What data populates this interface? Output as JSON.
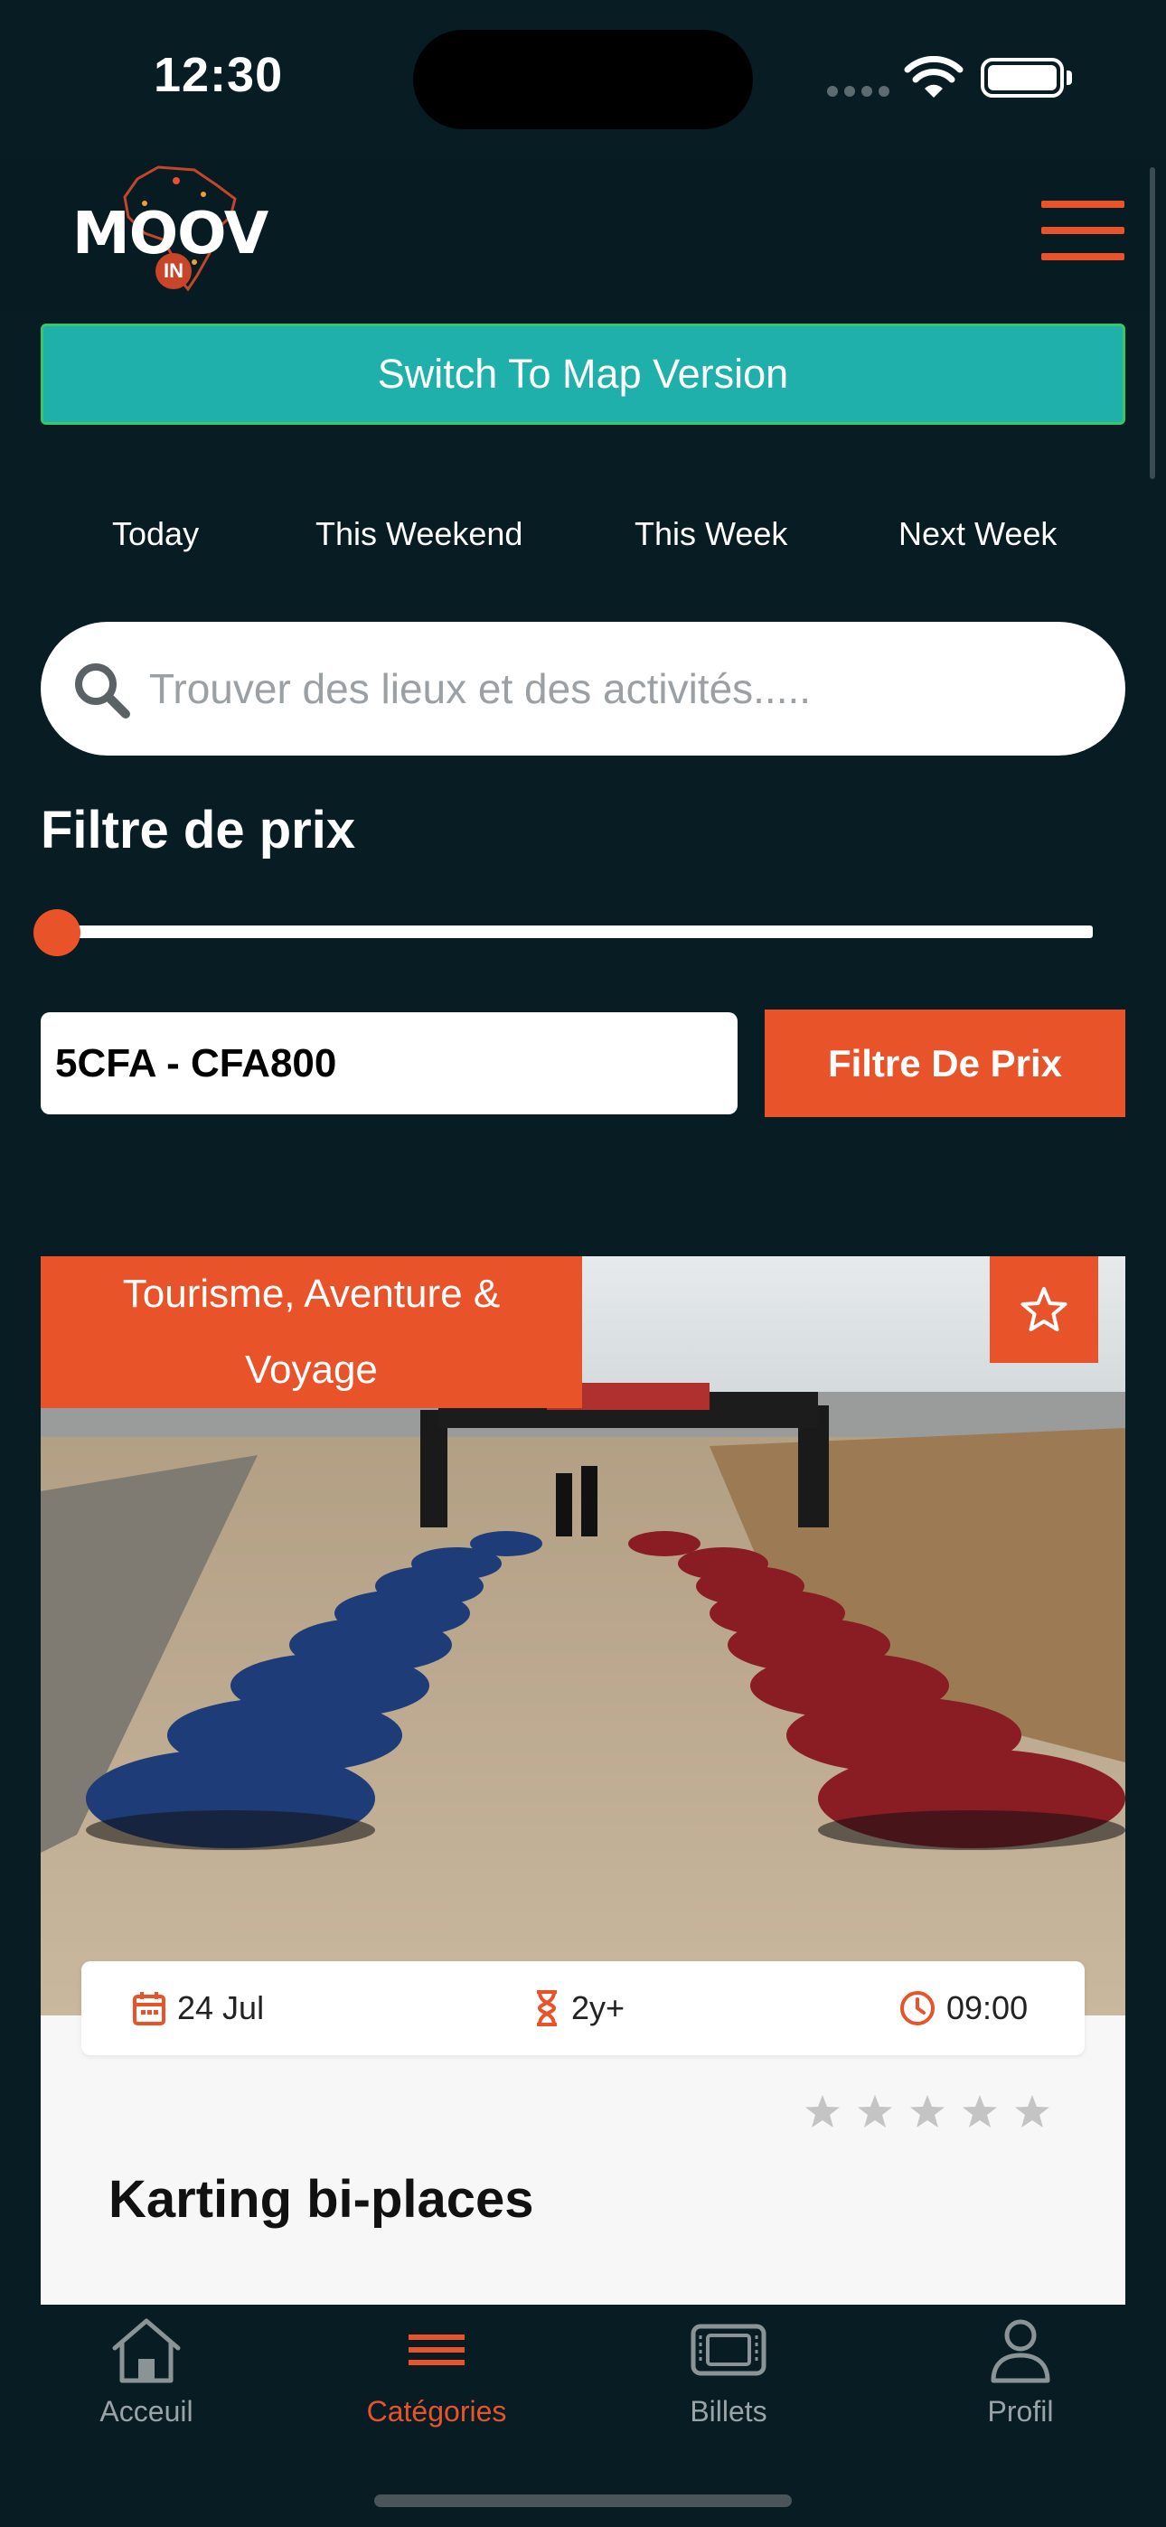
{
  "status": {
    "time": "12:30"
  },
  "header": {
    "logo_text": "MOOV",
    "logo_sub": "IN"
  },
  "map_switch": {
    "label": "Switch To Map Version"
  },
  "date_tabs": [
    "Today",
    "This Weekend",
    "This Week",
    "Next Week"
  ],
  "search": {
    "placeholder": "Trouver des lieux et des activités....."
  },
  "price_filter": {
    "title": "Filtre de prix",
    "range_text": "5CFA - CFA800",
    "button_label": "Filtre De Prix",
    "slider_position": 0
  },
  "card": {
    "category": "Tourisme, Aventure & Voyage",
    "date": "24 Jul",
    "age": "2y+",
    "time": "09:00",
    "rating": 0,
    "title": "Karting bi-places"
  },
  "tabs": [
    {
      "label": "Acceuil",
      "icon": "home-icon",
      "active": false
    },
    {
      "label": "Catégories",
      "icon": "menu-icon",
      "active": true
    },
    {
      "label": "Billets",
      "icon": "ticket-icon",
      "active": false
    },
    {
      "label": "Profil",
      "icon": "user-icon",
      "active": false
    }
  ],
  "colors": {
    "accent": "#e8532a",
    "teal": "#20b0ab",
    "background": "#071c23"
  }
}
